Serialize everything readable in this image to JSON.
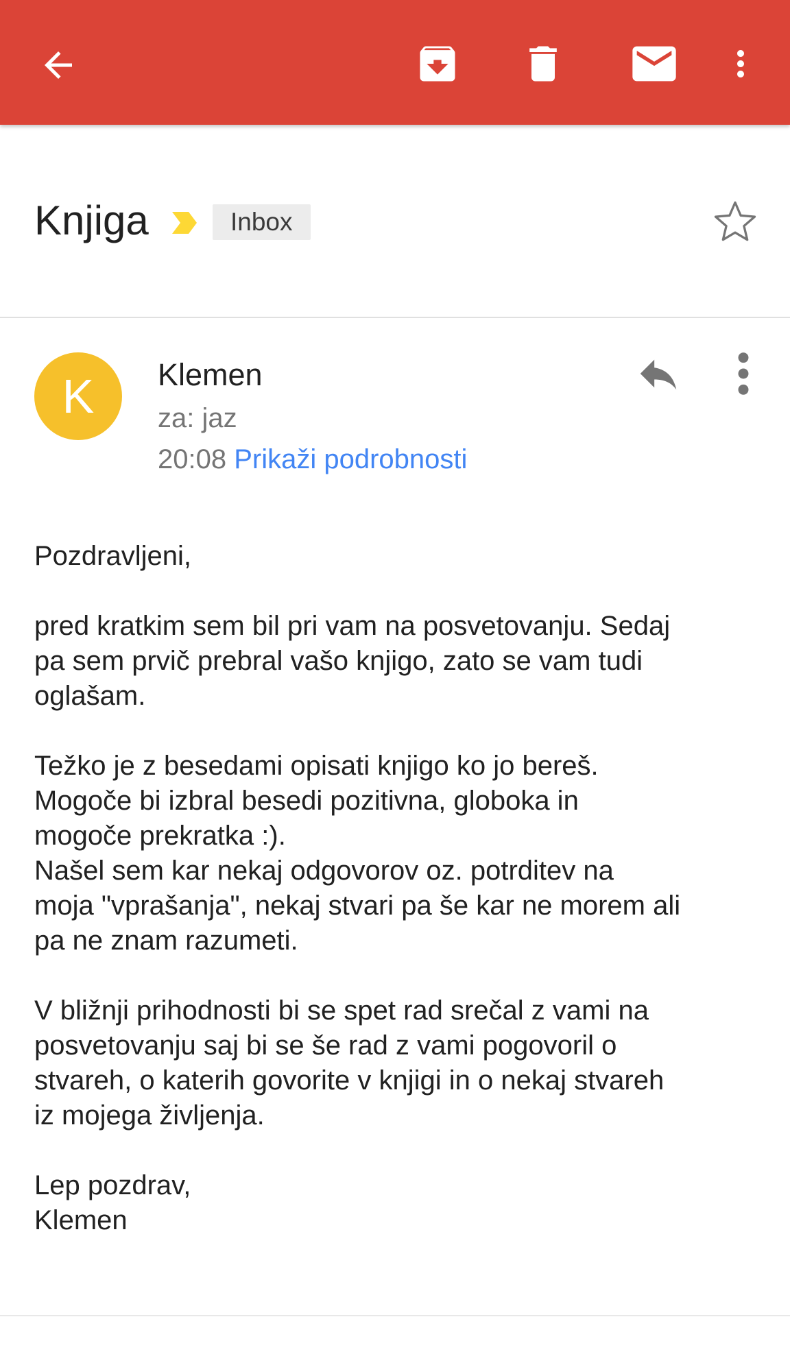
{
  "toolbar": {
    "background_color": "#db4437",
    "icons": {
      "back": "arrow-back-icon",
      "archive": "archive-icon",
      "delete": "trash-icon",
      "mark": "mail-icon",
      "more": "more-vert-icon"
    }
  },
  "subject": {
    "title": "Knjiga",
    "label": "Inbox",
    "importance_color": "#fdd835",
    "starred": false
  },
  "message": {
    "avatar_letter": "K",
    "avatar_color": "#f6c02b",
    "sender": "Klemen",
    "recipient": "za: jaz",
    "time": "20:08",
    "details_link": "Prikaži podrobnosti",
    "link_color": "#4285f4",
    "body": {
      "p1": "Pozdravljeni,",
      "p2": "pred kratkim sem bil pri vam na posvetovanju. Sedaj\npa sem prvič prebral vašo knjigo, zato se vam tudi\noglašam.",
      "p3": "Težko je z besedami opisati knjigo ko jo bereš.\nMogoče bi izbral besedi pozitivna, globoka in\nmogoče prekratka :).\nNašel sem kar nekaj odgovorov oz. potrditev na\nmoja \"vprašanja\", nekaj stvari pa še kar ne morem ali\npa ne znam razumeti.",
      "p4": "V bližnji prihodnosti bi se spet rad srečal z vami na\nposvetovanju saj bi se še rad z vami pogovoril o\nstvareh, o katerih govorite v knjigi in o nekaj stvareh\niz mojega življenja.",
      "p5": "Lep pozdrav,\nKlemen"
    }
  }
}
